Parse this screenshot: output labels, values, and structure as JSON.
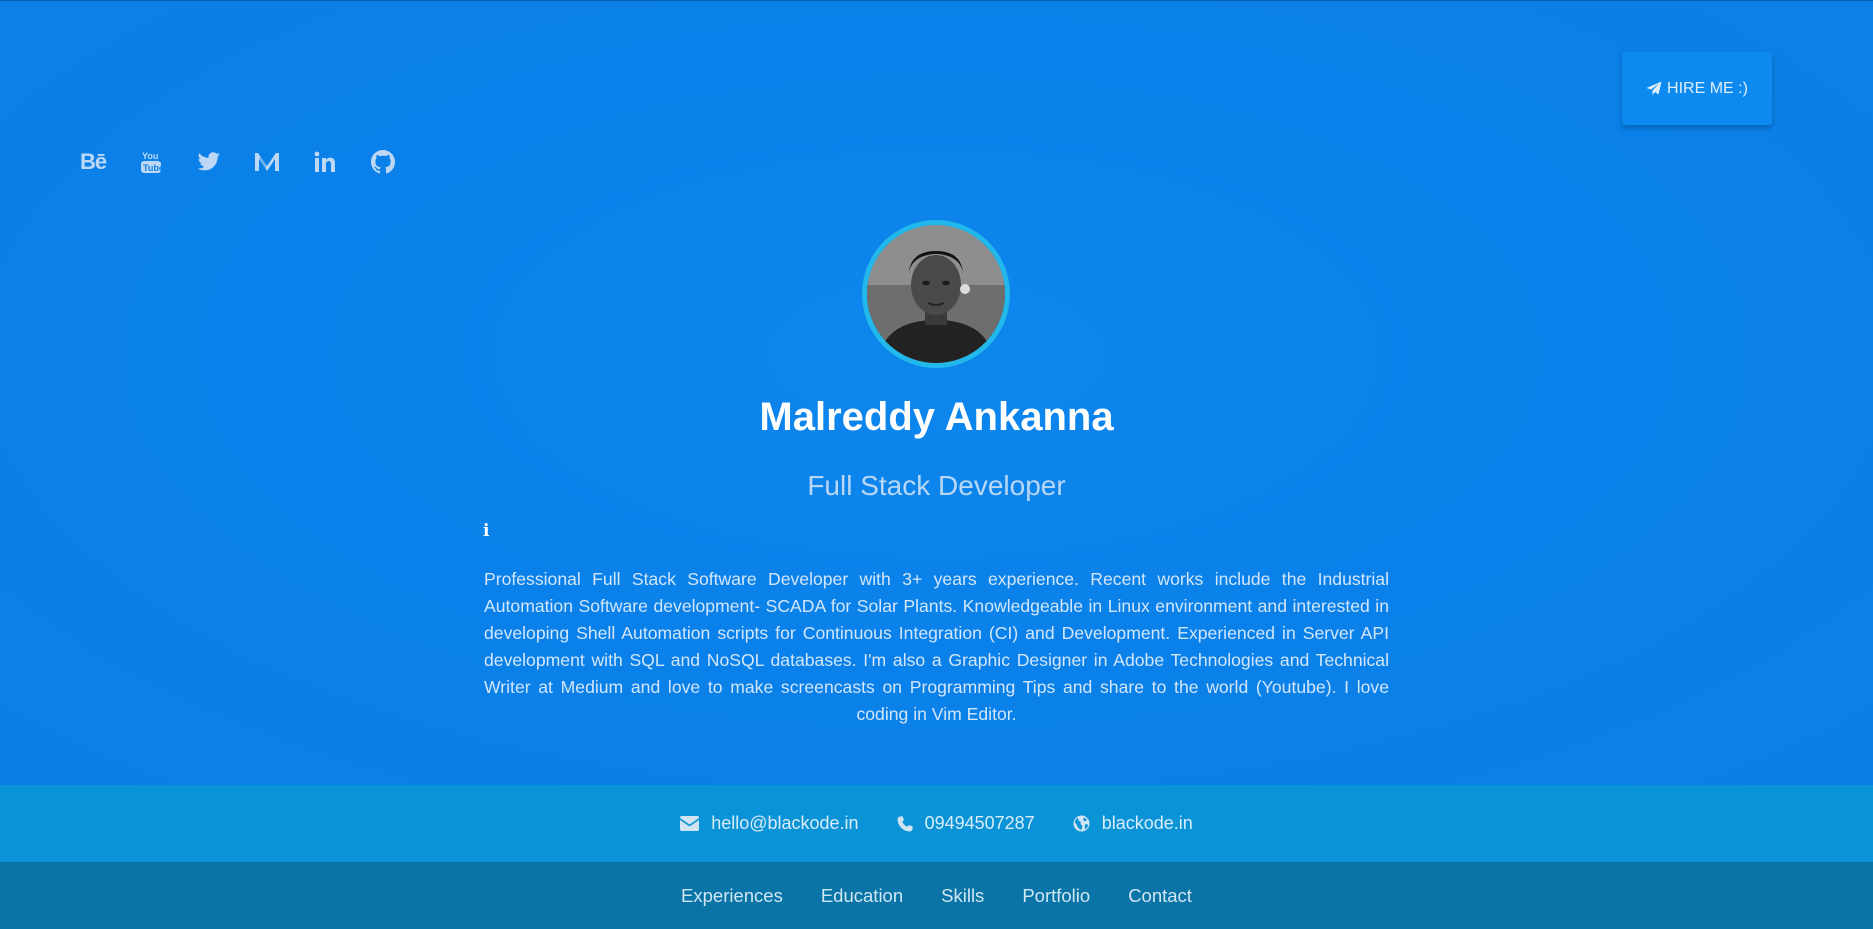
{
  "hire_button": {
    "label": "HIRE ME :)"
  },
  "social": {
    "behance_label": "Bē",
    "icons": [
      "behance-icon",
      "youtube-icon",
      "twitter-icon",
      "medium-icon",
      "linkedin-icon",
      "github-icon"
    ]
  },
  "profile": {
    "name": "Malreddy Ankanna",
    "role": "Full Stack Developer",
    "bio": "Professional Full Stack Software Developer with 3+ years experience. Recent works include the Industrial Automation Software development- SCADA for Solar Plants. Knowledgeable in Linux environment and interested in developing Shell Automation scripts for Continuous Integration (CI) and Development. Experienced in Server API development with SQL and NoSQL databases. I'm also a Graphic Designer in Adobe Technologies and Technical Writer at Medium and love to make screencasts on Programming Tips and share to the world (Youtube). I love coding in Vim Editor."
  },
  "contact": {
    "email": "hello@blackode.in",
    "phone": "09494507287",
    "website": "blackode.in"
  },
  "nav": {
    "items": [
      "Experiences",
      "Education",
      "Skills",
      "Portfolio",
      "Contact"
    ]
  },
  "colors": {
    "hero_bg": "#0a81ea",
    "contact_bar": "#0a93d6",
    "nav_bar": "#0a74a6",
    "avatar_ring": "#22b8ec"
  }
}
